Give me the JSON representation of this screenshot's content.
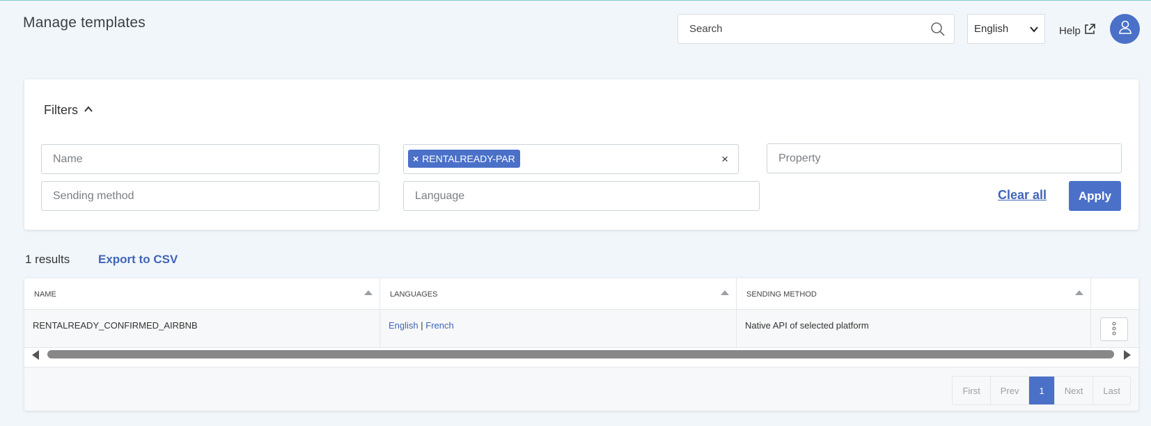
{
  "header": {
    "title": "Manage templates",
    "search_placeholder": "Search",
    "language": "English",
    "help_label": "Help"
  },
  "filters": {
    "title": "Filters",
    "name_placeholder": "Name",
    "chip_label": "RENTALREADY-PAR",
    "chip_remove": "×",
    "clear_symbol": "×",
    "property_placeholder": "Property",
    "sending_method_placeholder": "Sending method",
    "language_placeholder": "Language",
    "clear_all_label": "Clear all",
    "apply_label": "Apply"
  },
  "results": {
    "count_label": "1 results",
    "export_label": "Export to CSV"
  },
  "table": {
    "columns": [
      "NAME",
      "LANGUAGES",
      "SENDING METHOD"
    ],
    "rows": [
      {
        "name": "RENTALREADY_CONFIRMED_AIRBNB",
        "languages": [
          "English",
          "French"
        ],
        "language_separator": "|",
        "sending_method": "Native API of selected platform"
      }
    ]
  },
  "pagination": {
    "first": "First",
    "prev": "Prev",
    "current": "1",
    "next": "Next",
    "last": "Last"
  },
  "colors": {
    "accent": "#4a70c8",
    "link": "#3f64b8",
    "background": "#f1f6fa"
  },
  "icons": {
    "search": "search-icon",
    "language_dropdown": "chevron-down-icon",
    "help": "external-link-icon",
    "avatar": "user-icon",
    "filters_toggle": "chevron-up-icon",
    "row_actions": "kebab-menu-icon"
  }
}
